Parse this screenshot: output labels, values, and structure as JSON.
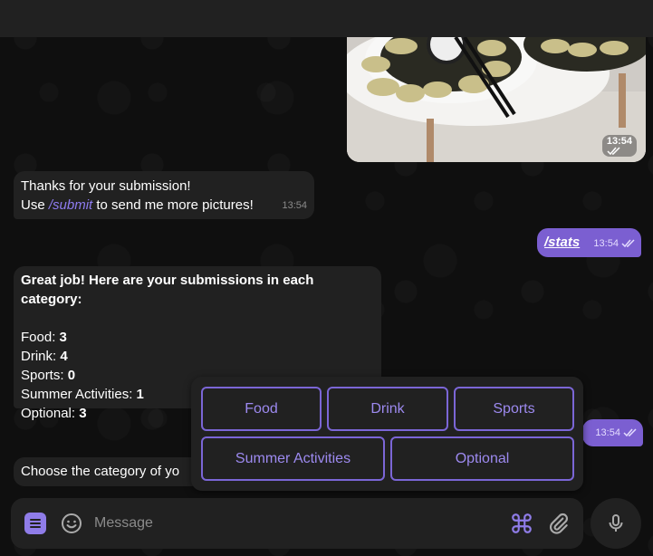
{
  "photo_message": {
    "time": "13:54"
  },
  "messages": {
    "thanks": {
      "line1": "Thanks for your submission!",
      "line2_prefix": "Use ",
      "line2_command": "/submit",
      "line2_suffix": " to send me more pictures!",
      "time": "13:54"
    },
    "stats_cmd": {
      "text": "/stats",
      "time": "13:54"
    },
    "stats_reply": {
      "header": "Great job! Here are your submissions in each category:",
      "items": [
        {
          "label": "Food: ",
          "value": "3"
        },
        {
          "label": "Drink: ",
          "value": "4"
        },
        {
          "label": "Sports: ",
          "value": "0"
        },
        {
          "label": "Summer Activities: ",
          "value": "1"
        },
        {
          "label": "Optional: ",
          "value": "3"
        }
      ]
    },
    "outgoing_partial": {
      "time": "13:54"
    },
    "choose_category": {
      "text": "Choose the category of yo"
    }
  },
  "keyboard": {
    "buttons": [
      "Food",
      "Drink",
      "Sports",
      "Summer Activities",
      "Optional"
    ]
  },
  "composer": {
    "placeholder": "Message"
  },
  "colors": {
    "accent": "#7b5fd1",
    "bubble_in": "#212121",
    "button_text": "#9d8af0",
    "link": "#8e7cf0"
  },
  "icons": [
    "menu-icon",
    "emoji-icon",
    "command-icon",
    "paperclip-icon",
    "microphone-icon",
    "double-check-icon"
  ]
}
